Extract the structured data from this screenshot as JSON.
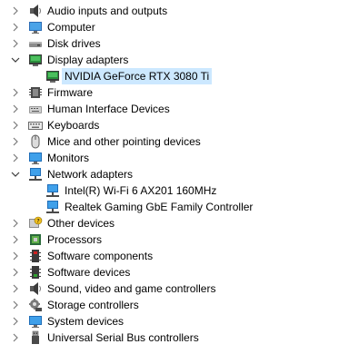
{
  "tree": {
    "items": [
      {
        "label": "Audio inputs and outputs",
        "icon": "speaker-icon",
        "expanded": false
      },
      {
        "label": "Computer",
        "icon": "computer-icon",
        "expanded": false
      },
      {
        "label": "Disk drives",
        "icon": "disk-drive-icon",
        "expanded": false
      },
      {
        "label": "Display adapters",
        "icon": "display-adapter-icon",
        "expanded": true
      },
      {
        "label": "NVIDIA GeForce RTX 3080 Ti",
        "icon": "display-adapter-icon",
        "selected": true
      },
      {
        "label": "Firmware",
        "icon": "firmware-icon",
        "expanded": false
      },
      {
        "label": "Human Interface Devices",
        "icon": "hid-icon",
        "expanded": false
      },
      {
        "label": "Keyboards",
        "icon": "keyboard-icon",
        "expanded": false
      },
      {
        "label": "Mice and other pointing devices",
        "icon": "mouse-icon",
        "expanded": false
      },
      {
        "label": "Monitors",
        "icon": "monitor-icon",
        "expanded": false
      },
      {
        "label": "Network adapters",
        "icon": "network-adapter-icon",
        "expanded": true
      },
      {
        "label": "Intel(R) Wi-Fi 6 AX201 160MHz",
        "icon": "network-adapter-icon"
      },
      {
        "label": "Realtek Gaming GbE Family Controller",
        "icon": "network-adapter-icon"
      },
      {
        "label": "Other devices",
        "icon": "unknown-device-icon",
        "expanded": false
      },
      {
        "label": "Processors",
        "icon": "processor-icon",
        "expanded": false
      },
      {
        "label": "Software components",
        "icon": "software-component-icon",
        "expanded": false
      },
      {
        "label": "Software devices",
        "icon": "software-device-icon",
        "expanded": false
      },
      {
        "label": "Sound, video and game controllers",
        "icon": "sound-icon",
        "expanded": false
      },
      {
        "label": "Storage controllers",
        "icon": "storage-controller-icon",
        "expanded": false
      },
      {
        "label": "System devices",
        "icon": "system-device-icon",
        "expanded": false
      },
      {
        "label": "Universal Serial Bus controllers",
        "icon": "usb-icon",
        "expanded": false
      }
    ]
  },
  "colors": {
    "selection": "#cce8ff",
    "chevron": "#7a7a7a",
    "icon_blue": "#1e8fd8"
  }
}
